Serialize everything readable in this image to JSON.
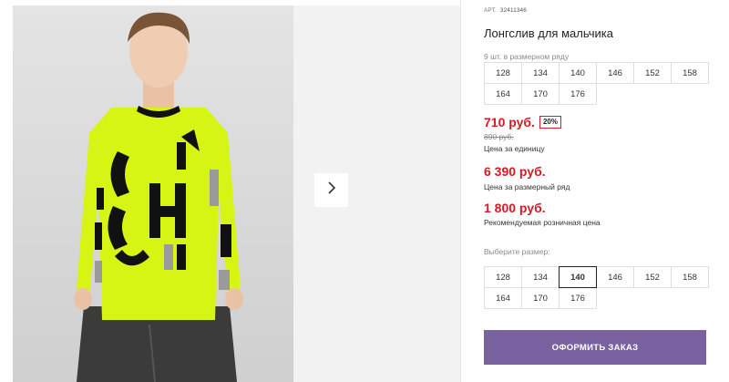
{
  "product": {
    "article_label": "АРТ.",
    "article_number": "32411346",
    "title": "Лонгслив для мальчика",
    "size_row_note": "9 шт. в размерном ряду"
  },
  "size_row": [
    "128",
    "134",
    "140",
    "146",
    "152",
    "158",
    "164",
    "170",
    "176"
  ],
  "pricing": {
    "unit_price": "710 руб.",
    "discount_badge": "20%",
    "old_price": "890 руб.",
    "unit_price_label": "Цена за единицу",
    "row_price": "6 390 руб.",
    "row_price_label": "Цена за размерный ряд",
    "retail_price": "1 800 руб.",
    "retail_price_label": "Рекомендуемая розничная цена"
  },
  "size_picker": {
    "label": "Выберите размер:",
    "options": [
      "128",
      "134",
      "140",
      "146",
      "152",
      "158",
      "164",
      "170",
      "176"
    ],
    "selected": "140"
  },
  "order_button_label": "ОФОРМИТЬ ЗАКАЗ",
  "colors": {
    "price_red": "#d41b26",
    "order_button": "#7a62a1",
    "shirt_neon": "#d6f514"
  },
  "icons": {
    "gallery_next": "chevron-right-icon"
  }
}
